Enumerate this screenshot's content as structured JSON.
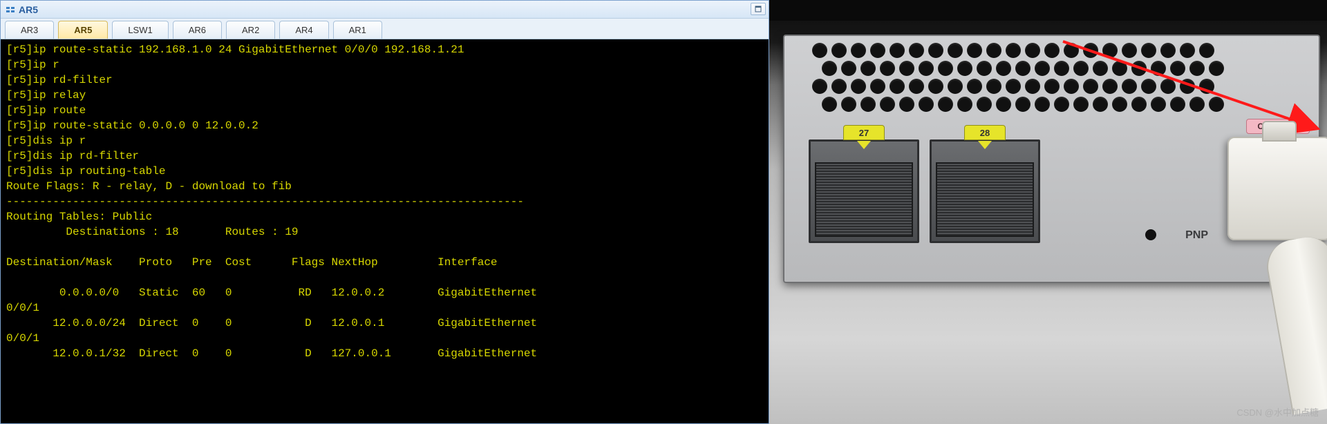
{
  "window": {
    "title": "AR5"
  },
  "tabs": [
    {
      "label": "AR3",
      "active": false
    },
    {
      "label": "AR5",
      "active": true
    },
    {
      "label": "LSW1",
      "active": false
    },
    {
      "label": "AR6",
      "active": false
    },
    {
      "label": "AR2",
      "active": false
    },
    {
      "label": "AR4",
      "active": false
    },
    {
      "label": "AR1",
      "active": false
    }
  ],
  "terminal_lines": [
    "[r5]ip route-static 192.168.1.0 24 GigabitEthernet 0/0/0 192.168.1.21",
    "[r5]ip r",
    "[r5]ip rd-filter",
    "[r5]ip relay",
    "[r5]ip route",
    "[r5]ip route-static 0.0.0.0 0 12.0.0.2",
    "[r5]dis ip r",
    "[r5]dis ip rd-filter",
    "[r5]dis ip routing-table",
    "Route Flags: R - relay, D - download to fib",
    "------------------------------------------------------------------------------",
    "Routing Tables: Public",
    "         Destinations : 18       Routes : 19",
    "",
    "Destination/Mask    Proto   Pre  Cost      Flags NextHop         Interface",
    "",
    "        0.0.0.0/0   Static  60   0          RD   12.0.0.2        GigabitEthernet",
    "0/0/1",
    "       12.0.0.0/24  Direct  0    0           D   12.0.0.1        GigabitEthernet",
    "0/0/1",
    "       12.0.0.1/32  Direct  0    0           D   127.0.0.1       GigabitEthernet"
  ],
  "ports": {
    "p1": "27",
    "p2": "28",
    "console": "CONSOLE",
    "pnp": "PNP"
  },
  "watermark": "CSDN @水中加点糖"
}
